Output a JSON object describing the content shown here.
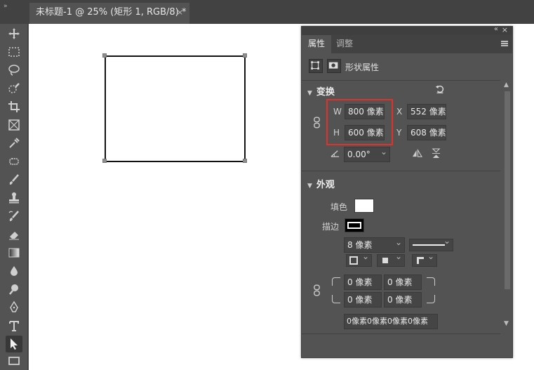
{
  "tab": {
    "title": "未标题-1 @ 25% (矩形 1, RGB/8) *",
    "close": "×"
  },
  "topbar": {
    "collapse": "»"
  },
  "toolbar": {
    "tools": [
      "move-tool-icon",
      "marquee-tool-icon",
      "lasso-tool-icon",
      "quick-select-tool-icon",
      "crop-tool-icon",
      "frame-tool-icon",
      "eyedropper-tool-icon",
      "healing-brush-icon",
      "brush-tool-icon",
      "stamp-tool-icon",
      "history-brush-icon",
      "eraser-tool-icon",
      "gradient-tool-icon",
      "blur-tool-icon",
      "dodge-tool-icon",
      "pen-tool-icon",
      "type-tool-icon",
      "path-select-tool-icon",
      "rectangle-tool-icon"
    ],
    "active": "path-select-tool-icon"
  },
  "panel": {
    "double_arrow": "«",
    "close": "×",
    "tabs": {
      "properties": "属性",
      "adjustments": "调整"
    },
    "kind_label": "形状属性",
    "transform": {
      "title": "变换",
      "w_label": "W",
      "w_value": "800 像素",
      "h_label": "H",
      "h_value": "600 像素",
      "x_label": "X",
      "x_value": "552 像素",
      "y_label": "Y",
      "y_value": "608 像素",
      "angle_value": "0.00°"
    },
    "appearance": {
      "title": "外观",
      "fill_label": "填色",
      "stroke_label": "描边",
      "stroke_width": "8 像素",
      "radius_tl": "0 像素",
      "radius_tr": "0 像素",
      "radius_bl": "0 像素",
      "radius_br": "0 像素",
      "radius_all": "0像素0像素0像素0像素"
    }
  },
  "colors": {
    "accent_red": "#e0322b",
    "fill": "#ffffff",
    "stroke": "#000000",
    "ui_bg": "#535353"
  }
}
